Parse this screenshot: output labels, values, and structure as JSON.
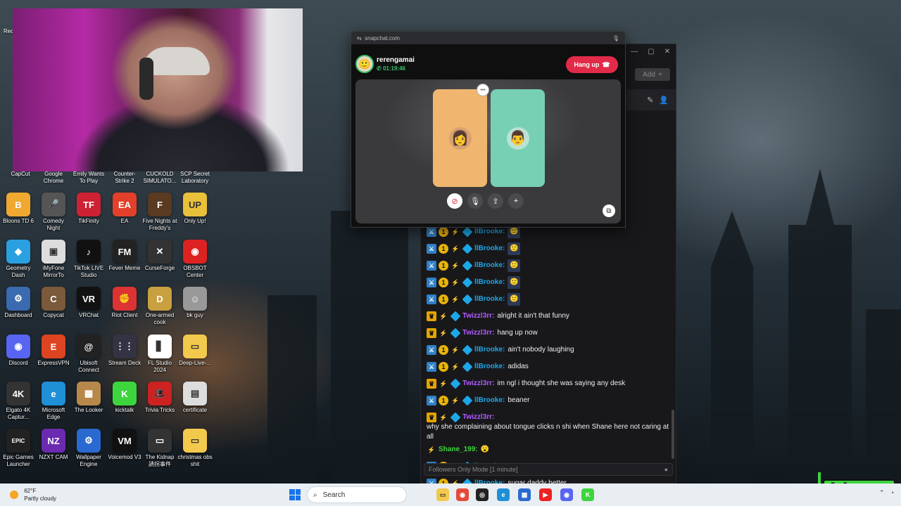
{
  "desktop": {
    "top_labels": [
      "Rec",
      "CapCut",
      "Google Chrome",
      "Emily Wants To Play",
      "Counter-Strike 2",
      "CUCKOLD SIMULATO...",
      "SCP Secret Laboratory"
    ],
    "icons": [
      {
        "label": "Bloons TD 6",
        "icon": "bloons-icon",
        "color": "#f0a830",
        "glyph": "B"
      },
      {
        "label": "Comedy Night",
        "icon": "microphone-icon",
        "color": "#555",
        "glyph": "🎤"
      },
      {
        "label": "TikFinity",
        "icon": "tikfinity-icon",
        "color": "#c23",
        "glyph": "TF"
      },
      {
        "label": "EA",
        "icon": "ea-icon",
        "color": "#e2402a",
        "glyph": "EA"
      },
      {
        "label": "Five Nights at Freddy's",
        "icon": "freddy-icon",
        "color": "#5a3a20",
        "glyph": "F"
      },
      {
        "label": "Only Up!",
        "icon": "onlyup-icon",
        "color": "#e9c03a",
        "glyph": "UP"
      },
      {
        "label": "Geometry Dash",
        "icon": "geometry-dash-icon",
        "color": "#2aa0e0",
        "glyph": "◆"
      },
      {
        "label": "iMyFone MirrorTo",
        "icon": "mirrorto-icon",
        "color": "#ddd",
        "glyph": "▣"
      },
      {
        "label": "TikTok LIVE Studio",
        "icon": "tiktok-icon",
        "color": "#111",
        "glyph": "♪"
      },
      {
        "label": "Fever Meme",
        "icon": "fevermeme-icon",
        "color": "#222",
        "glyph": "FM"
      },
      {
        "label": "CurseForge",
        "icon": "curseforge-icon",
        "color": "#333",
        "glyph": "✕"
      },
      {
        "label": "OBSBOT Center",
        "icon": "obsbot-icon",
        "color": "#d22",
        "glyph": "◉"
      },
      {
        "label": "Dashboard",
        "icon": "dashboard-icon",
        "color": "#3a6ab0",
        "glyph": "⚙"
      },
      {
        "label": "Copycat",
        "icon": "copycat-icon",
        "color": "#7a5a3a",
        "glyph": "C"
      },
      {
        "label": "VRChat",
        "icon": "vrchat-icon",
        "color": "#111",
        "glyph": "VR"
      },
      {
        "label": "Riot Client",
        "icon": "riot-icon",
        "color": "#d33",
        "glyph": "✊"
      },
      {
        "label": "One-armed cook",
        "icon": "cook-icon",
        "color": "#c8a040",
        "glyph": "D"
      },
      {
        "label": "bk guy",
        "icon": "bkguy-icon",
        "color": "#999",
        "glyph": "☺"
      },
      {
        "label": "Discord",
        "icon": "discord-icon",
        "color": "#5865f2",
        "glyph": "◉"
      },
      {
        "label": "ExpressVPN",
        "icon": "expressvpn-icon",
        "color": "#d42",
        "glyph": "E"
      },
      {
        "label": "Ubisoft Connect",
        "icon": "ubisoft-icon",
        "color": "#222",
        "glyph": "@"
      },
      {
        "label": "Stream Deck",
        "icon": "streamdeck-icon",
        "color": "#334",
        "glyph": "⋮⋮"
      },
      {
        "label": "FL Studio 2024",
        "icon": "flstudio-icon",
        "color": "#fff",
        "glyph": "▋"
      },
      {
        "label": "Deep-Live-...",
        "icon": "folder-icon",
        "color": "#f2c94c",
        "glyph": "▭"
      },
      {
        "label": "Elgato 4K Captur...",
        "icon": "elgato-icon",
        "color": "#333",
        "glyph": "4K"
      },
      {
        "label": "Microsoft Edge",
        "icon": "edge-icon",
        "color": "#1f8fd6",
        "glyph": "e"
      },
      {
        "label": "The Looker",
        "icon": "looker-icon",
        "color": "#b8884a",
        "glyph": "▦"
      },
      {
        "label": "kicktalk",
        "icon": "kicktalk-icon",
        "color": "#3dd53d",
        "glyph": "K"
      },
      {
        "label": "Trivia Tricks",
        "icon": "trivia-icon",
        "color": "#c22",
        "glyph": "🎩"
      },
      {
        "label": "certificate",
        "icon": "certificate-icon",
        "color": "#ddd",
        "glyph": "▤"
      },
      {
        "label": "Epic Games Launcher",
        "icon": "epic-icon",
        "color": "#222",
        "glyph": "EPIC"
      },
      {
        "label": "NZXT CAM",
        "icon": "nzxt-icon",
        "color": "#6a2bb0",
        "glyph": "NZ"
      },
      {
        "label": "Wallpaper Engine",
        "icon": "wallpaper-engine-icon",
        "color": "#2a6ad0",
        "glyph": "⚙"
      },
      {
        "label": "Voicemod V3",
        "icon": "voicemod-icon",
        "color": "#111",
        "glyph": "VM"
      },
      {
        "label": "The Kidnap 誘拐事件",
        "icon": "kidnap-icon",
        "color": "#333",
        "glyph": "▭"
      },
      {
        "label": "christmas obs shit",
        "icon": "folder-icon",
        "color": "#f2c94c",
        "glyph": "▭"
      }
    ]
  },
  "snapchat": {
    "url": "snapchat.com",
    "contact_name": "rerengamai",
    "call_timer": "01:19:46",
    "hangup_label": "Hang up"
  },
  "chat": {
    "input_placeholder": "Followers Only Mode [1 minute]",
    "add_label": "Add",
    "messages": [
      {
        "user": "llBrooke:",
        "color": "#1ea7e6",
        "text": "",
        "badges": [
          "mod",
          "prime",
          "sword",
          "cube"
        ],
        "emote": true
      },
      {
        "user": "llBrooke:",
        "color": "#1ea7e6",
        "text": "",
        "badges": [
          "mod",
          "prime",
          "sword",
          "cube"
        ],
        "emote": true
      },
      {
        "user": "llBrooke:",
        "color": "#1ea7e6",
        "text": "",
        "badges": [
          "mod",
          "prime",
          "sword",
          "cube"
        ],
        "emote": true
      },
      {
        "user": "llBrooke:",
        "color": "#1ea7e6",
        "text": "",
        "badges": [
          "mod",
          "prime",
          "sword",
          "cube"
        ],
        "emote": true
      },
      {
        "user": "llBrooke:",
        "color": "#1ea7e6",
        "text": "",
        "badges": [
          "mod",
          "prime",
          "sword",
          "cube"
        ],
        "emote": true
      },
      {
        "user": "Twizzl3rr:",
        "color": "#b05cff",
        "text": "alright it ain't that funny",
        "badges": [
          "vip",
          "sword",
          "cube"
        ],
        "emote": false
      },
      {
        "user": "Twizzl3rr:",
        "color": "#b05cff",
        "text": "hang up now",
        "badges": [
          "vip",
          "sword",
          "cube"
        ],
        "emote": false
      },
      {
        "user": "llBrooke:",
        "color": "#1ea7e6",
        "text": "ain't nobody laughing",
        "badges": [
          "mod",
          "prime",
          "sword",
          "cube"
        ],
        "emote": false
      },
      {
        "user": "llBrooke:",
        "color": "#1ea7e6",
        "text": "adidas",
        "badges": [
          "mod",
          "prime",
          "sword",
          "cube"
        ],
        "emote": false
      },
      {
        "user": "Twizzl3rr:",
        "color": "#b05cff",
        "text": "im ngl i thought she was saying any desk",
        "badges": [
          "vip",
          "sword",
          "cube"
        ],
        "emote": false
      },
      {
        "user": "llBrooke:",
        "color": "#1ea7e6",
        "text": "beaner",
        "badges": [
          "mod",
          "prime",
          "sword",
          "cube"
        ],
        "emote": false
      },
      {
        "user": "Twizzl3rr:",
        "color": "#b05cff",
        "text": "why she complaining about tongue clicks n shi when Shane here not caring at all",
        "badges": [
          "vip",
          "sword",
          "cube"
        ],
        "emote": false
      },
      {
        "user": "Shane_199:",
        "color": "#3dd53d",
        "text": "😮",
        "badges": [
          "sword"
        ],
        "emote": false
      },
      {
        "user": "llBrooke:",
        "color": "#1ea7e6",
        "text": "Fr",
        "badges": [
          "mod",
          "prime",
          "sword",
          "cube"
        ],
        "emote": false
      },
      {
        "user": "llBrooke:",
        "color": "#1ea7e6",
        "text": "sugar daddy better",
        "badges": [
          "mod",
          "prime",
          "sword",
          "cube"
        ],
        "emote": false
      }
    ]
  },
  "taskbar": {
    "temperature": "62°F",
    "weather": "Partly cloudy",
    "search_label": "Search",
    "apps": [
      {
        "icon": "file-explorer-icon",
        "color": "#f2c94c",
        "glyph": "▭"
      },
      {
        "icon": "chrome-icon",
        "color": "#e24a3a",
        "glyph": "◉"
      },
      {
        "icon": "obs-icon",
        "color": "#222",
        "glyph": "◎"
      },
      {
        "icon": "edge-icon",
        "color": "#1f8fd6",
        "glyph": "e"
      },
      {
        "icon": "store-icon",
        "color": "#2a6ad0",
        "glyph": "▦"
      },
      {
        "icon": "youtube-icon",
        "color": "#e22",
        "glyph": "▶"
      },
      {
        "icon": "discord-icon",
        "color": "#5865f2",
        "glyph": "◉"
      },
      {
        "icon": "kick-icon",
        "color": "#3dd53d",
        "glyph": "K"
      }
    ]
  },
  "watermark": "himay"
}
